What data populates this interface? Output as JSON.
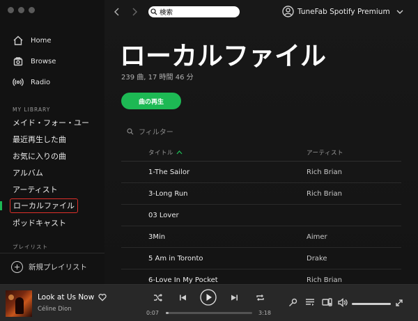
{
  "sidebar": {
    "nav": [
      {
        "label": "Home",
        "icon": "home-icon"
      },
      {
        "label": "Browse",
        "icon": "browse-icon"
      },
      {
        "label": "Radio",
        "icon": "radio-icon"
      }
    ],
    "library_heading": "MY LIBRARY",
    "library_items": [
      {
        "label": "メイド・フォー・ユー"
      },
      {
        "label": "最近再生した曲"
      },
      {
        "label": "お気に入りの曲"
      },
      {
        "label": "アルバム"
      },
      {
        "label": "アーティスト"
      },
      {
        "label": "ローカルファイル",
        "active": true
      },
      {
        "label": "ポッドキャスト"
      }
    ],
    "playlists_heading": "プレイリスト",
    "new_playlist_label": "新規プレイリスト"
  },
  "topbar": {
    "search_value": "検索",
    "user_name": "TuneFab Spotify Premium"
  },
  "main": {
    "title": "ローカルファイル",
    "summary": "239 曲, 17 時間 46 分",
    "play_button_label": "曲の再生",
    "filter_placeholder": "フィルター",
    "columns": {
      "title": "タイトル",
      "artist": "アーティスト"
    },
    "rows": [
      {
        "title": "1-The Sailor",
        "artist": "Rich Brian"
      },
      {
        "title": "3-Long Run",
        "artist": "Rich Brian"
      },
      {
        "title": "03 Lover",
        "artist": ""
      },
      {
        "title": "3Min",
        "artist": "Aimer"
      },
      {
        "title": "5 Am in Toronto",
        "artist": "Drake"
      },
      {
        "title": "6-Love In My Pocket",
        "artist": "Rich Brian"
      }
    ]
  },
  "player": {
    "track_title": "Look at Us Now",
    "track_artist": "Céline Dion",
    "elapsed": "0:07",
    "duration": "3:18",
    "progress_fraction": 0.035,
    "volume_fraction": 1.0
  },
  "colors": {
    "accent": "#1db954",
    "highlight_box": "#e0302a",
    "background": "#121212",
    "player_bar": "#282828"
  }
}
